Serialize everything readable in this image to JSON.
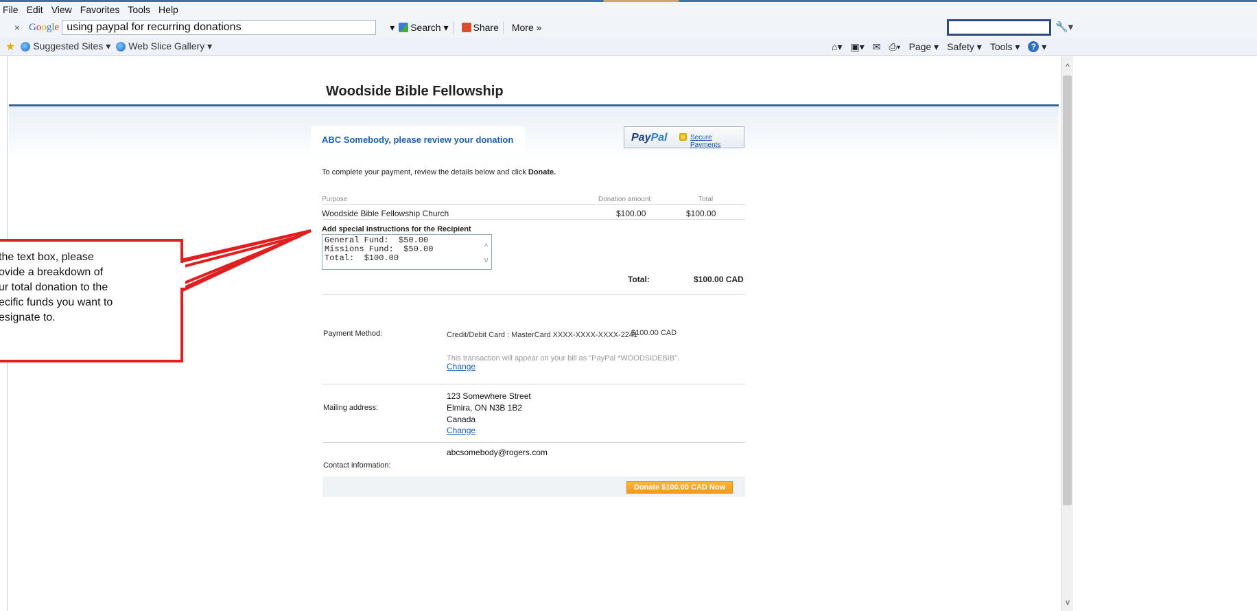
{
  "menubar": {
    "items": [
      "File",
      "Edit",
      "View",
      "Favorites",
      "Tools",
      "Help"
    ]
  },
  "toolbar": {
    "close_glyph": "×",
    "google_query": "using paypal for recurring donations",
    "search_label": "Search",
    "share_label": "Share",
    "more_label": "More »"
  },
  "favorites": {
    "suggested_sites": "Suggested Sites ▾",
    "web_slice_gallery": "Web Slice Gallery ▾"
  },
  "command_bar": {
    "page": "Page ▾",
    "safety": "Safety ▾",
    "tools": "Tools ▾"
  },
  "site": {
    "title": "Woodside Bible Fellowship"
  },
  "review": {
    "heading": "ABC Somebody, please review your donation"
  },
  "paypal": {
    "logo_pay": "Pay",
    "logo_pal": "Pal",
    "secure_link": "Secure Payments"
  },
  "intro": {
    "text": "To complete your payment, review the details below and click ",
    "bold": "Donate."
  },
  "table": {
    "headers": {
      "purpose": "Purpose",
      "donation_amount": "Donation amount",
      "total": "Total"
    },
    "row": {
      "purpose": "Woodside Bible Fellowship Church",
      "donation_amount": "$100.00",
      "total": "$100.00"
    }
  },
  "instructions": {
    "label": "Add special instructions for the Recipient",
    "value": "General Fund:  $50.00\nMissions Fund:  $50.00\nTotal:  $100.00"
  },
  "summary": {
    "total_label": "Total:",
    "total_value": "$100.00 CAD"
  },
  "payment": {
    "label": "Payment Method:",
    "method": "Credit/Debit Card : MasterCard XXXX-XXXX-XXXX-2241",
    "amount": "$100.00 CAD",
    "note": "This transaction will appear on your bill as \"PayPal *WOODSIDEBIB\".",
    "change": "Change"
  },
  "mailing": {
    "label": "Mailing address:",
    "line1": "123 Somewhere Street",
    "line2": "Elmira, ON N3B 1B2",
    "line3": "Canada",
    "change": "Change"
  },
  "contact": {
    "label": "Contact information:",
    "email": "abcsomebody@rogers.com"
  },
  "donate_button": "Donate $100.00 CAD Now",
  "callout": {
    "lines": [
      "the text box, please",
      "ovide a breakdown of",
      "ur total donation to the",
      "ecific funds you want to",
      "esignate to."
    ]
  },
  "colors": {
    "accent_blue": "#1a5fa8",
    "header_rule": "#3b628f",
    "callout_red": "#e02020",
    "donate_orange": "#f39b1a"
  }
}
